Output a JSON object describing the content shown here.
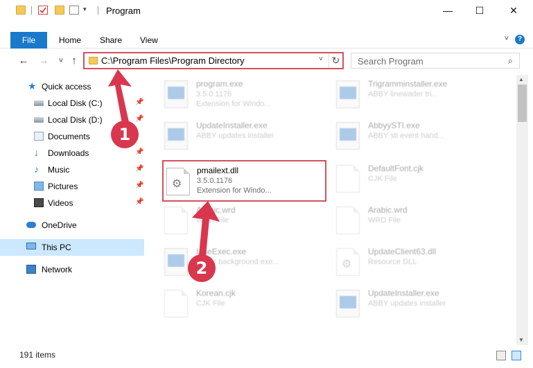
{
  "window": {
    "title": "Program",
    "controls": {
      "minimize": "—",
      "maximize": "☐",
      "close": "✕"
    }
  },
  "ribbon": {
    "tabs": [
      "File",
      "Home",
      "Share",
      "View"
    ],
    "expand_icon": "chevron-down",
    "help_icon": "?"
  },
  "address": {
    "back": "←",
    "forward": "→",
    "recent": "˅",
    "up": "↑",
    "path": "C:\\Program Files\\Program Directory",
    "dropdown": "˅",
    "refresh": "↻"
  },
  "search": {
    "placeholder": "Search Program",
    "icon": "⌕"
  },
  "sidebar": {
    "items": [
      {
        "label": "Quick access",
        "icon": "star"
      },
      {
        "label": "Local Disk (C:)",
        "icon": "disk"
      },
      {
        "label": "Local Disk (D:)",
        "icon": "disk"
      },
      {
        "label": "Documents",
        "icon": "documents"
      },
      {
        "label": "Downloads",
        "icon": "downloads"
      },
      {
        "label": "Music",
        "icon": "music"
      },
      {
        "label": "Pictures",
        "icon": "pictures"
      },
      {
        "label": "Videos",
        "icon": "videos"
      },
      {
        "label": "OneDrive",
        "icon": "cloud"
      },
      {
        "label": "This PC",
        "icon": "computer"
      },
      {
        "label": "Network",
        "icon": "network"
      }
    ],
    "pin": "📌",
    "selected": "This PC"
  },
  "files": [
    {
      "name": "program.exe",
      "line2": "3.5.0.1176",
      "line3": "Extension for Windo...",
      "icon": "exe"
    },
    {
      "name": "Trigramminstaller.exe",
      "line2": "ABBY linewader tri...",
      "line3": "",
      "icon": "exe"
    },
    {
      "name": "UpdateInstaller.exe",
      "line2": "ABBY updates installer",
      "line3": "",
      "icon": "exe"
    },
    {
      "name": "AbbyySTI.exe",
      "line2": "ABBY sti event hand...",
      "line3": "",
      "icon": "exe"
    },
    {
      "name": "pmailext.dll",
      "line2": "3.5.0.1176",
      "line3": "Extension for Windo...",
      "icon": "dll"
    },
    {
      "name": "DefaultFont.cjk",
      "line2": "CJK File",
      "line3": "",
      "icon": "doc"
    },
    {
      "name": "Arabic.wrd",
      "line2": "WRD File",
      "line3": "",
      "icon": "doc"
    },
    {
      "name": "Arabic.wrd",
      "line2": "WRD File",
      "line3": "",
      "icon": "doc"
    },
    {
      "name": "LineExec.exe",
      "line2": "ABBY background exe...",
      "line3": "",
      "icon": "exe"
    },
    {
      "name": "UpdateClient63.dll",
      "line2": "Resource DLL",
      "line3": "",
      "icon": "dll"
    },
    {
      "name": "Korean.cjk",
      "line2": "CJK File",
      "line3": "",
      "icon": "doc"
    },
    {
      "name": "UpdateInstaller.exe",
      "line2": "ABBY updates installer",
      "line3": "",
      "icon": "exe"
    }
  ],
  "status": {
    "count": "191 items"
  },
  "annotations": {
    "marker_1": "1",
    "marker_2": "2",
    "color": "#d8374d"
  },
  "colors": {
    "accent": "#1979ca",
    "highlight": "#d64f5c",
    "selection": "#cce8ff"
  }
}
